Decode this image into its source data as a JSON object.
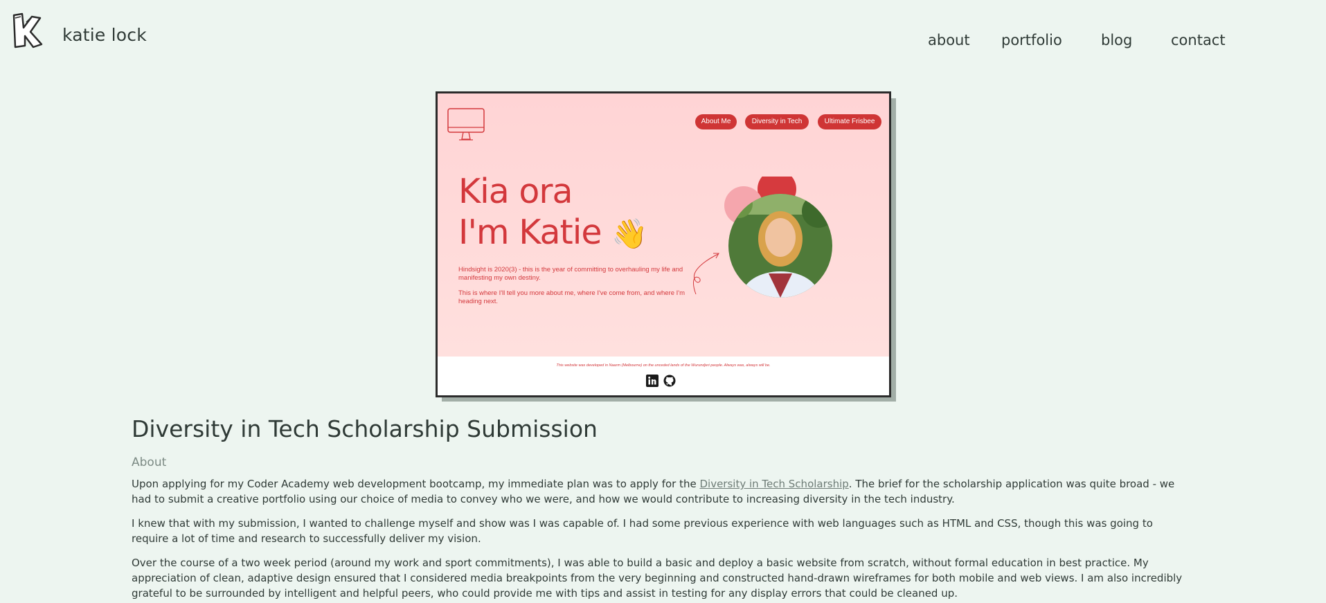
{
  "header": {
    "title": "katie lock",
    "logo_icon": "k-letter-logo-icon",
    "nav": [
      "about",
      "portfolio",
      "blog",
      "contact"
    ]
  },
  "screenshot": {
    "nav_pills": [
      "About Me",
      "Diversity in Tech",
      "Ultimate Frisbee"
    ],
    "hero_line1": "Kia ora",
    "hero_line2": "I'm Katie",
    "hero_emoji": "👋",
    "para1": "Hindsight is 2020(3) - this is the year of committing to overhauling my life and manifesting my own destiny.",
    "para2": "This is where I'll tell you more about me, where I've come from, and where I'm heading next.",
    "acknowledgement": "This website was developed in Naarm (Melbourne) on the unceded lands of the Wurundjeri people. Always was, always will be.",
    "social_icons": [
      "linkedin-icon",
      "github-icon"
    ],
    "colors": {
      "accent": "#cf3535",
      "background": "#ffd9d8"
    }
  },
  "article": {
    "title": "Diversity in Tech Scholarship Submission",
    "section_heading": "About",
    "p1_before": "Upon applying for my Coder Academy web development bootcamp, my immediate plan was to apply for the ",
    "p1_link": "Diversity in Tech Scholarship",
    "p1_after": ". The brief for the scholarship application was quite broad - we had to submit a creative portfolio using our choice of media to convey who we were, and how we would contribute to increasing diversity in the tech industry.",
    "p2": "I knew that with my submission, I wanted to challenge myself and show was I was capable of. I had some previous experience with web languages such as HTML and CSS, though this was going to require a lot of time and research to successfully deliver my vision.",
    "p3": "Over the course of a two week period (around my work and sport commitments), I was able to build a basic and deploy a basic website from scratch, without formal education in best practice. My appreciation of clean, adaptive design ensured that I considered media breakpoints from the very beginning and constructed hand-drawn wireframes for both mobile and web views. I am also incredibly grateful to be surrounded by intelligent and helpful peers, who could provide me with tips and assist in testing for any display errors that could be cleaned up."
  },
  "colors": {
    "page_bg": "#edf5f0",
    "text": "#2f3a36",
    "muted": "#7c8a84"
  }
}
